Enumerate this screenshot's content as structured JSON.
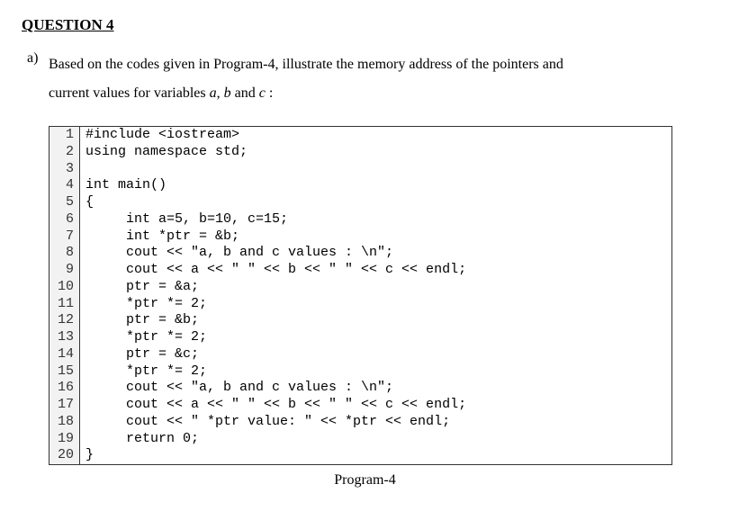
{
  "heading": "QUESTION 4",
  "item_letter": "a)",
  "prompt_line1": "Based on the codes given in Program-4, illustrate the memory address of the pointers and",
  "prompt_line2_pre": "current values for variables ",
  "var_a": "a",
  "sep1": ", ",
  "var_b": "b",
  "sep2": " and ",
  "var_c": "c",
  "prompt_line2_post": " :",
  "code_lines": [
    {
      "n": "1",
      "t": "#include <iostream>"
    },
    {
      "n": "2",
      "t": "using namespace std;"
    },
    {
      "n": "3",
      "t": ""
    },
    {
      "n": "4",
      "t": "int main()"
    },
    {
      "n": "5",
      "t": "{"
    },
    {
      "n": "6",
      "t": "     int a=5, b=10, c=15;"
    },
    {
      "n": "7",
      "t": "     int *ptr = &b;"
    },
    {
      "n": "8",
      "t": "     cout << \"a, b and c values : \\n\";"
    },
    {
      "n": "9",
      "t": "     cout << a << \" \" << b << \" \" << c << endl;"
    },
    {
      "n": "10",
      "t": "     ptr = &a;"
    },
    {
      "n": "11",
      "t": "     *ptr *= 2;"
    },
    {
      "n": "12",
      "t": "     ptr = &b;"
    },
    {
      "n": "13",
      "t": "     *ptr *= 2;"
    },
    {
      "n": "14",
      "t": "     ptr = &c;"
    },
    {
      "n": "15",
      "t": "     *ptr *= 2;"
    },
    {
      "n": "16",
      "t": "     cout << \"a, b and c values : \\n\";"
    },
    {
      "n": "17",
      "t": "     cout << a << \" \" << b << \" \" << c << endl;"
    },
    {
      "n": "18",
      "t": "     cout << \" *ptr value: \" << *ptr << endl;"
    },
    {
      "n": "19",
      "t": "     return 0;"
    },
    {
      "n": "20",
      "t": "}"
    }
  ],
  "caption": "Program-4"
}
